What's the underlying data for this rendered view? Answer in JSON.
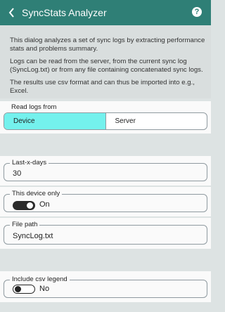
{
  "header": {
    "title": "SyncStats Analyzer",
    "back_icon": "chevron-left-icon",
    "help_icon": "question-circle-icon",
    "help_glyph": "?"
  },
  "description": {
    "p1": "This dialog analyzes a set of sync logs by extracting performance stats and problems summary.",
    "p2": "Logs can be read from the server, from the current sync log (SyncLog.txt) or from any file containing concatenated sync logs.",
    "p3": "The results use csv format and can thus be imported into e.g., Excel."
  },
  "read_logs": {
    "label": "Read logs from",
    "options": [
      "Device",
      "Server"
    ],
    "selected": "Device"
  },
  "last_x_days": {
    "label": "Last-x-days",
    "value": "30"
  },
  "this_device_only": {
    "label": "This device only",
    "state": "On",
    "on": true
  },
  "file_path": {
    "label": "File path",
    "value": "SyncLog.txt"
  },
  "include_csv_legend": {
    "label": "Include csv legend",
    "state": "No",
    "on": false
  },
  "colors": {
    "titlebar": "#2f7f76",
    "selected_segment": "#74f1ed",
    "background": "#dde3e3",
    "panel": "#fafafa"
  }
}
